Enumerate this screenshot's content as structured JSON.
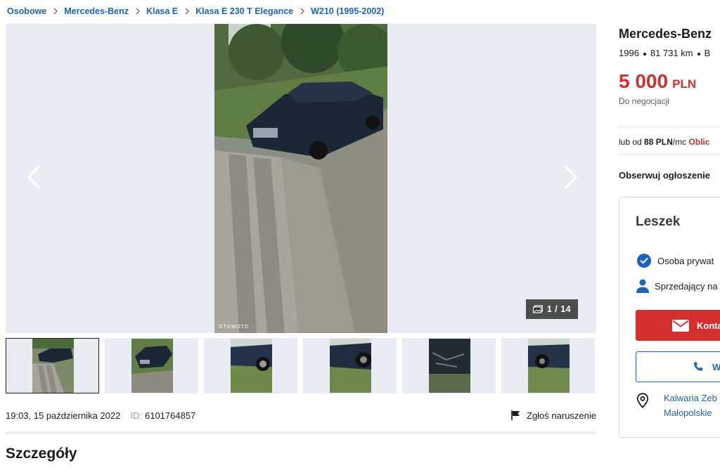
{
  "breadcrumb": [
    "Osobowe",
    "Mercedes-Benz",
    "Klasa E",
    "Klasa E 230 T Elegance",
    "W210 (1995-2002)"
  ],
  "gallery": {
    "counter": "1 / 14",
    "watermark": "OTOMOTO",
    "thumbnail_count": 6
  },
  "listing": {
    "date": "19:03, 15 października 2022",
    "id_label": "ID:",
    "id_value": "6101764857",
    "report_label": "Zgłoś naruszenie",
    "section_title": "Szczegóły"
  },
  "sidebar": {
    "title": "Mercedes-Benz",
    "specs": {
      "year": "1996",
      "mileage": "81 731 km",
      "next": "B"
    },
    "price_amount": "5 000",
    "price_currency": "PLN",
    "negotiable": "Do negocjacji",
    "finance_prefix": "lub od",
    "finance_amount": "88 PLN",
    "finance_suffix": "/mc",
    "finance_link": "Oblic",
    "observe_label": "Obserwuj ogłoszenie",
    "seller": {
      "name": "Leszek",
      "type": "Osoba prywat",
      "since": "Sprzedający na",
      "contact_label": "Konta",
      "phone_label": "W",
      "location_line1": "Kalwaria Zeb",
      "location_line2": "Małopolskie"
    }
  },
  "colors": {
    "link": "#1f63b5",
    "price": "#d32f2f",
    "gallery_bg": "#e9ecf2"
  }
}
